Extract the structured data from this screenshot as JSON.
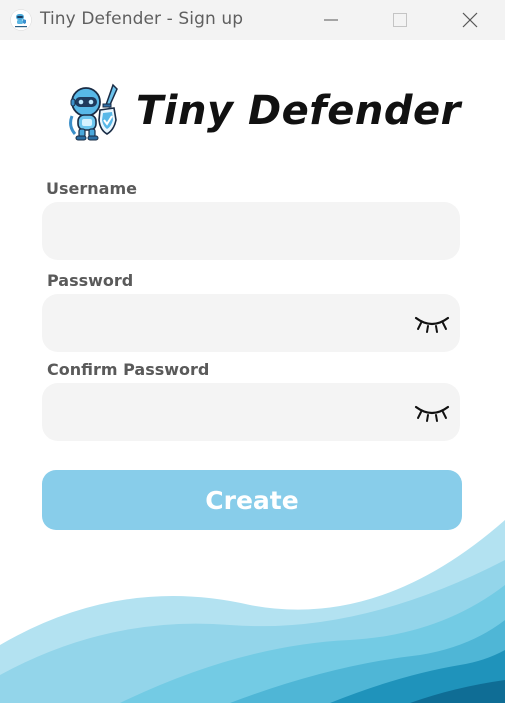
{
  "window": {
    "title": "Tiny Defender - Sign up",
    "controls": {
      "minimize_icon": "minimize-icon",
      "maximize_icon": "maximize-icon",
      "close_icon": "close-icon"
    }
  },
  "header": {
    "brand": "Tiny Defender",
    "logo_icon": "robot-knight-icon"
  },
  "form": {
    "username": {
      "label": "Username",
      "value": "",
      "placeholder": ""
    },
    "password": {
      "label": "Password",
      "value": "",
      "placeholder": "",
      "toggle_icon": "eye-closed-icon"
    },
    "confirm_password": {
      "label": "Confirm Password",
      "value": "",
      "placeholder": "",
      "toggle_icon": "eye-closed-icon"
    },
    "submit_label": "Create"
  },
  "colors": {
    "accent": "#88cdea",
    "field_bg": "#f4f4f4",
    "titlebar_bg": "#f3f3f3",
    "wave_light": "#a9def0",
    "wave_mid": "#5fc0db",
    "wave_dark": "#1b87ad"
  }
}
